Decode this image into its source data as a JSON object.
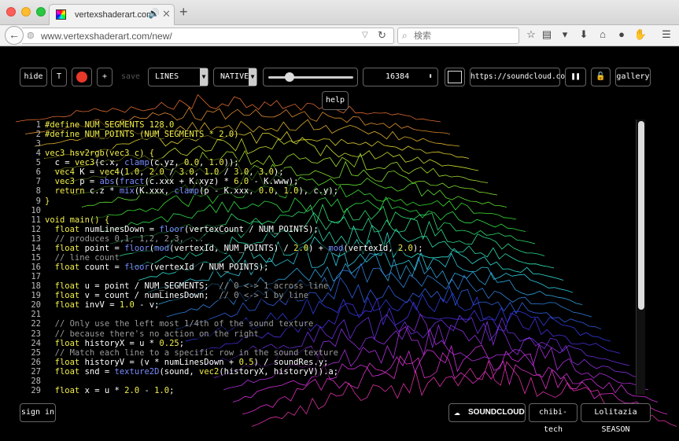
{
  "browser": {
    "tab_title": "vertexshaderart.com",
    "tab_audio_icon": "🔊",
    "tab_close": "✕",
    "new_tab": "+",
    "back_icon": "←",
    "url": "www.vertexshaderart.com/new/",
    "search_placeholder": "検索",
    "toolbar_icons": [
      "star-icon",
      "reading-list-icon",
      "pocket-icon",
      "download-icon",
      "home-icon",
      "chat-icon",
      "hand-icon",
      "menu-icon"
    ]
  },
  "controls": {
    "hide": "hide",
    "text_toggle": "T",
    "plus": "+",
    "save": "save",
    "mode": "LINES",
    "blend": "NATIVE",
    "slider_value": 0.22,
    "vertex_count": "16384",
    "soundcloud_url": "https://soundcloud.com",
    "pause": "❚❚",
    "lock": "🔓",
    "gallery": "gallery",
    "help": "help",
    "sign_in": "sign in",
    "soundcloud_label": "SOUNDCLOUD",
    "artist": "chibi-tech",
    "track": "Lolitazia SEASON"
  },
  "colors": {
    "record_button": "#e8382a",
    "keyword": "#f2ef4a",
    "function": "#7a8cff",
    "comment": "#999999"
  },
  "code_lines": [
    {
      "n": "1",
      "tokens": [
        [
          "k",
          "#define NUM_SEGMENTS 128.0"
        ]
      ]
    },
    {
      "n": "2",
      "tokens": [
        [
          "k",
          "#define NUM_POINTS (NUM_SEGMENTS * 2.0)"
        ]
      ]
    },
    {
      "n": "3",
      "tokens": []
    },
    {
      "n": "4",
      "tokens": [
        [
          "k",
          "vec3 hsv2rgb(vec3 c) {"
        ]
      ]
    },
    {
      "n": "5",
      "tokens": [
        [
          "t",
          "  c = "
        ],
        [
          "k",
          "vec3"
        ],
        [
          "t",
          "(c.x, "
        ],
        [
          "f",
          "clamp"
        ],
        [
          "t",
          "(c.yz, "
        ],
        [
          "n",
          "0.0"
        ],
        [
          "t",
          ", "
        ],
        [
          "n",
          "1.0"
        ],
        [
          "t",
          "));"
        ]
      ]
    },
    {
      "n": "6",
      "tokens": [
        [
          "k",
          "  vec4"
        ],
        [
          "t",
          " K = "
        ],
        [
          "k",
          "vec4"
        ],
        [
          "t",
          "("
        ],
        [
          "n",
          "1.0"
        ],
        [
          "t",
          ", "
        ],
        [
          "n",
          "2.0"
        ],
        [
          "t",
          " / "
        ],
        [
          "n",
          "3.0"
        ],
        [
          "t",
          ", "
        ],
        [
          "n",
          "1.0"
        ],
        [
          "t",
          " / "
        ],
        [
          "n",
          "3.0"
        ],
        [
          "t",
          ", "
        ],
        [
          "n",
          "3.0"
        ],
        [
          "t",
          ");"
        ]
      ]
    },
    {
      "n": "7",
      "tokens": [
        [
          "k",
          "  vec3"
        ],
        [
          "t",
          " p = "
        ],
        [
          "f",
          "abs"
        ],
        [
          "t",
          "("
        ],
        [
          "f",
          "fract"
        ],
        [
          "t",
          "(c.xxx + K.xyz) * "
        ],
        [
          "n",
          "6.0"
        ],
        [
          "t",
          " - K.www);"
        ]
      ]
    },
    {
      "n": "8",
      "tokens": [
        [
          "k",
          "  return"
        ],
        [
          "t",
          " c.z * "
        ],
        [
          "f",
          "mix"
        ],
        [
          "t",
          "(K.xxx, "
        ],
        [
          "f",
          "clamp"
        ],
        [
          "t",
          "(p - K.xxx, "
        ],
        [
          "n",
          "0.0"
        ],
        [
          "t",
          ", "
        ],
        [
          "n",
          "1.0"
        ],
        [
          "t",
          "), c.y);"
        ]
      ]
    },
    {
      "n": "9",
      "tokens": [
        [
          "k",
          "}"
        ]
      ]
    },
    {
      "n": "10",
      "tokens": []
    },
    {
      "n": "11",
      "tokens": [
        [
          "k",
          "void main() {"
        ]
      ]
    },
    {
      "n": "12",
      "tokens": [
        [
          "k",
          "  float"
        ],
        [
          "t",
          " numLinesDown = "
        ],
        [
          "f",
          "floor"
        ],
        [
          "t",
          "(vertexCount / NUM_POINTS);"
        ]
      ]
    },
    {
      "n": "13",
      "tokens": [
        [
          "c",
          "  // produces 0,1, 1,2, 2,3, ..."
        ]
      ]
    },
    {
      "n": "14",
      "tokens": [
        [
          "k",
          "  float"
        ],
        [
          "t",
          " point = "
        ],
        [
          "f",
          "floor"
        ],
        [
          "t",
          "("
        ],
        [
          "f",
          "mod"
        ],
        [
          "t",
          "(vertexId, NUM_POINTS) / "
        ],
        [
          "n",
          "2.0"
        ],
        [
          "t",
          ") + "
        ],
        [
          "f",
          "mod"
        ],
        [
          "t",
          "(vertexId, "
        ],
        [
          "n",
          "2.0"
        ],
        [
          "t",
          ");"
        ]
      ]
    },
    {
      "n": "15",
      "tokens": [
        [
          "c",
          "  // line count"
        ]
      ]
    },
    {
      "n": "16",
      "tokens": [
        [
          "k",
          "  float"
        ],
        [
          "t",
          " count = "
        ],
        [
          "f",
          "floor"
        ],
        [
          "t",
          "(vertexId / NUM_POINTS);"
        ]
      ]
    },
    {
      "n": "17",
      "tokens": []
    },
    {
      "n": "18",
      "tokens": [
        [
          "k",
          "  float"
        ],
        [
          "t",
          " u = point / NUM_SEGMENTS;  "
        ],
        [
          "c",
          "// 0 <-> 1 across line"
        ]
      ]
    },
    {
      "n": "19",
      "tokens": [
        [
          "k",
          "  float"
        ],
        [
          "t",
          " v = count / numLinesDown;  "
        ],
        [
          "c",
          "// 0 <-> 1 by line"
        ]
      ]
    },
    {
      "n": "20",
      "tokens": [
        [
          "k",
          "  float"
        ],
        [
          "t",
          " invV = "
        ],
        [
          "n",
          "1.0"
        ],
        [
          "t",
          " - v;"
        ]
      ]
    },
    {
      "n": "21",
      "tokens": []
    },
    {
      "n": "22",
      "tokens": [
        [
          "c",
          "  // Only use the left most 1/4th of the sound texture"
        ]
      ]
    },
    {
      "n": "23",
      "tokens": [
        [
          "c",
          "  // because there's no action on the right"
        ]
      ]
    },
    {
      "n": "24",
      "tokens": [
        [
          "k",
          "  float"
        ],
        [
          "t",
          " historyX = u * "
        ],
        [
          "n",
          "0.25"
        ],
        [
          "t",
          ";"
        ]
      ]
    },
    {
      "n": "25",
      "tokens": [
        [
          "c",
          "  // Match each line to a specific row in the sound texture"
        ]
      ]
    },
    {
      "n": "26",
      "tokens": [
        [
          "k",
          "  float"
        ],
        [
          "t",
          " historyV = (v * numLinesDown + "
        ],
        [
          "n",
          "0.5"
        ],
        [
          "t",
          ") / soundRes.y;"
        ]
      ]
    },
    {
      "n": "27",
      "tokens": [
        [
          "k",
          "  float"
        ],
        [
          "t",
          " snd = "
        ],
        [
          "f",
          "texture2D"
        ],
        [
          "t",
          "(sound, "
        ],
        [
          "k",
          "vec2"
        ],
        [
          "t",
          "(historyX, historyV)).a;"
        ]
      ]
    },
    {
      "n": "28",
      "tokens": []
    },
    {
      "n": "29",
      "tokens": [
        [
          "k",
          "  float"
        ],
        [
          "t",
          " x = u * "
        ],
        [
          "n",
          "2.0"
        ],
        [
          "t",
          " - "
        ],
        [
          "n",
          "1.0"
        ],
        [
          "t",
          ";"
        ]
      ]
    }
  ]
}
